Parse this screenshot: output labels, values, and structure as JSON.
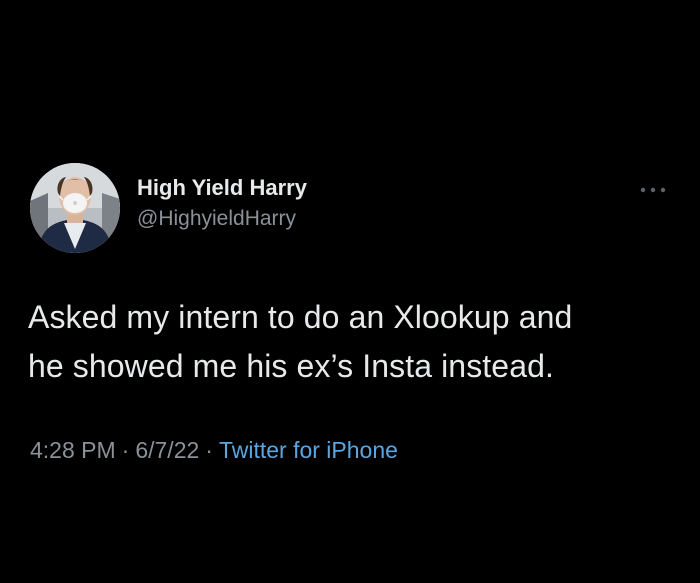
{
  "tweet": {
    "author": {
      "name": "High Yield Harry",
      "handle": "@HighyieldHarry"
    },
    "text_lines": [
      "Asked my intern to do an Xlookup and",
      "he showed me his ex’s Insta instead."
    ],
    "time": "4:28 PM",
    "separator": "·",
    "date": "6/7/22",
    "source": "Twitter for iPhone",
    "more_icon": "more-horizontal-icon"
  },
  "colors": {
    "background": "#000000",
    "primary_text": "#e7e9ea",
    "secondary_text": "#8b9197",
    "link": "#5ba6e0"
  }
}
